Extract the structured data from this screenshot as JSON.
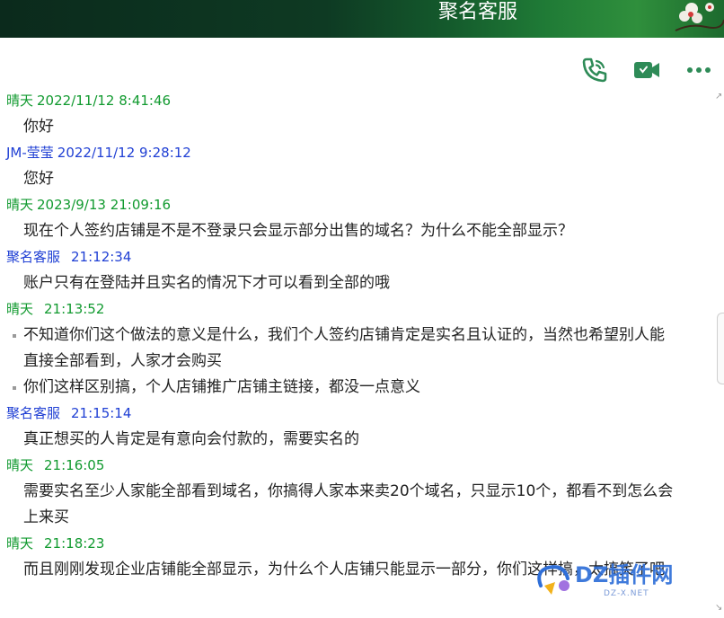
{
  "header": {
    "title": "聚名客服"
  },
  "toolbar": {
    "icons": [
      "phone-icon",
      "video-icon",
      "more-icon"
    ],
    "accent": "#2e8b57"
  },
  "messages": [
    {
      "sender": "晴天",
      "time": "2022/11/12 8:41:46",
      "role": "peer",
      "lines": [
        "你好"
      ]
    },
    {
      "sender": "JM-莹莹",
      "time": "2022/11/12 9:28:12",
      "role": "agent",
      "lines": [
        "您好"
      ]
    },
    {
      "sender": "晴天",
      "time": "2023/9/13 21:09:16",
      "role": "peer",
      "lines": [
        "现在个人签约店铺是不是不登录只会显示部分出售的域名？为什么不能全部显示？"
      ]
    },
    {
      "sender": "聚名客服",
      "time": "21:12:34",
      "role": "agent",
      "lines": [
        "账户只有在登陆并且实名的情况下才可以看到全部的哦"
      ]
    },
    {
      "sender": "晴天",
      "time": "21:13:52",
      "role": "peer",
      "lines": [
        "不知道你们这个做法的意义是什么，我们个人签约店铺肯定是实名且认证的，当然也希望别人能",
        "直接全部看到，人家才会购买",
        "你们这样区别搞，个人店铺推广店铺主链接，都没一点意义"
      ],
      "bulleted": [
        0,
        2
      ]
    },
    {
      "sender": "聚名客服",
      "time": "21:15:14",
      "role": "agent",
      "lines": [
        "真正想买的人肯定是有意向会付款的，需要实名的"
      ]
    },
    {
      "sender": "晴天",
      "time": "21:16:05",
      "role": "peer",
      "lines": [
        "需要实名至少人家能全部看到域名，你搞得人家本来卖20个域名，只显示10个，都看不到怎么会",
        "上来买"
      ]
    },
    {
      "sender": "晴天",
      "time": "21:18:23",
      "role": "peer",
      "lines": [
        "而且刚刚发现企业店铺能全部显示，为什么个人店铺只能显示一部分，你们这样搞，太搞笑了吧"
      ]
    }
  ],
  "watermark": {
    "text": "DZ插件网",
    "sub": "DZ-X.NET"
  },
  "colors": {
    "peer": "#119a2f",
    "agent": "#1f3fd4",
    "header": "#0e3a23"
  }
}
